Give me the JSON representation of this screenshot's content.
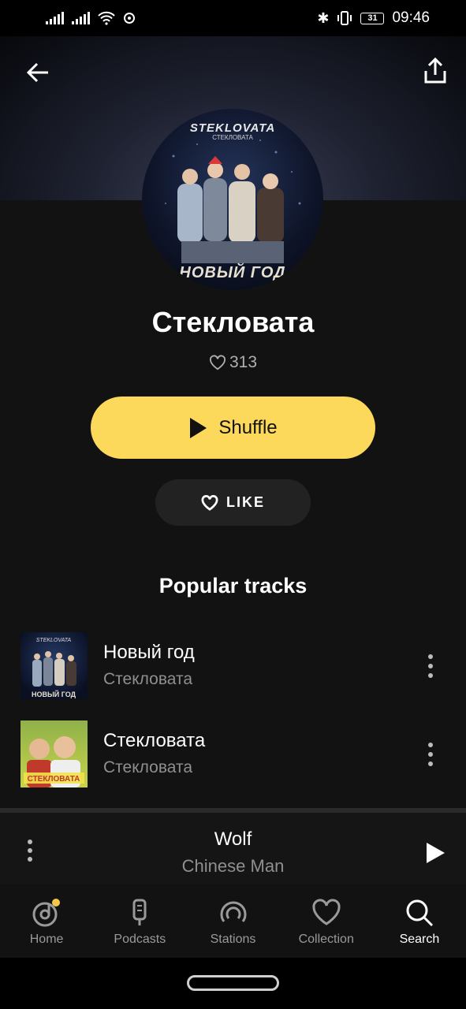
{
  "status_bar": {
    "time": "09:46",
    "battery": "31"
  },
  "header": {
    "back_icon": "arrow-left-icon",
    "share_icon": "share-icon"
  },
  "cover": {
    "logo": "STEKLOVATA",
    "logo_sub": "СТЕКЛОВАТА",
    "footer": "НОВЫЙ ГОД"
  },
  "artist": {
    "name": "Стекловата",
    "likes": "313"
  },
  "actions": {
    "shuffle_label": "Shuffle",
    "like_label": "LIKE"
  },
  "popular": {
    "title": "Popular tracks",
    "tracks": [
      {
        "title": "Новый год",
        "artist": "Стекловата"
      },
      {
        "title": "Стекловата",
        "artist": "Стекловата"
      }
    ]
  },
  "mini_player": {
    "title": "Wolf",
    "artist": "Chinese Man"
  },
  "nav": {
    "items": [
      {
        "label": "Home"
      },
      {
        "label": "Podcasts"
      },
      {
        "label": "Stations"
      },
      {
        "label": "Collection"
      },
      {
        "label": "Search"
      }
    ]
  },
  "colors": {
    "accent": "#fcd95b",
    "background": "#121212",
    "notification_dot": "#f5c84a"
  }
}
